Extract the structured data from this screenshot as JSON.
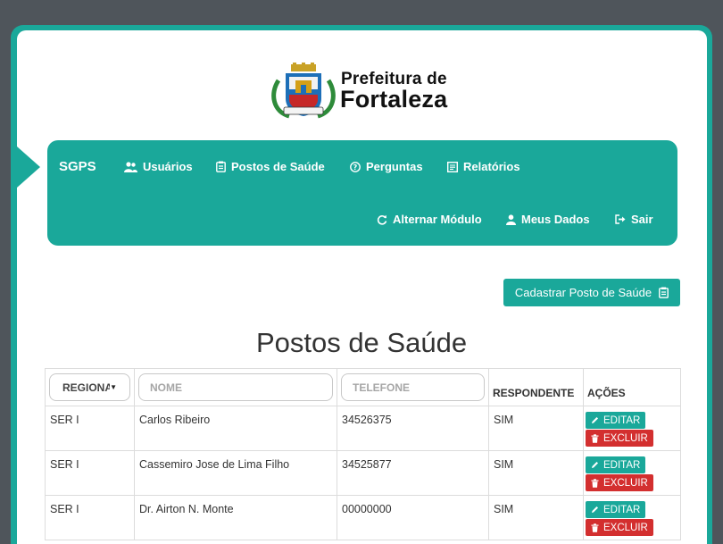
{
  "logo": {
    "line1": "Prefeitura de",
    "line2": "Fortaleza",
    "motto": "FORTITUDINE"
  },
  "navbar": {
    "brand": "SGPS",
    "items": [
      {
        "label": "Usuários",
        "icon": "users-icon"
      },
      {
        "label": "Postos de Saúde",
        "icon": "clipboard-icon"
      },
      {
        "label": "Perguntas",
        "icon": "question-circle-icon"
      },
      {
        "label": "Relatórios",
        "icon": "report-icon"
      }
    ],
    "right_items": [
      {
        "label": "Alternar Módulo",
        "icon": "refresh-icon"
      },
      {
        "label": "Meus Dados",
        "icon": "user-icon"
      },
      {
        "label": "Sair",
        "icon": "sign-out-icon"
      }
    ]
  },
  "add_button": {
    "label": "Cadastrar Posto de Saúde",
    "icon": "clipboard-icon"
  },
  "page_title": "Postos de Saúde",
  "table": {
    "filters": {
      "regional": "REGIONAL",
      "nome_placeholder": "NOME",
      "telefone_placeholder": "TELEFONE"
    },
    "headers": {
      "respondente": "RESPONDENTE",
      "acoes": "AÇÕES"
    },
    "edit_label": "EDITAR",
    "delete_label": "EXCLUIR",
    "rows": [
      {
        "regional": "SER I",
        "nome": "Carlos Ribeiro",
        "telefone": "34526375",
        "respondente": "SIM"
      },
      {
        "regional": "SER I",
        "nome": "Cassemiro Jose de Lima Filho",
        "telefone": "34525877",
        "respondente": "SIM"
      },
      {
        "regional": "SER I",
        "nome": "Dr. Airton N. Monte",
        "telefone": "00000000",
        "respondente": "SIM"
      }
    ]
  },
  "colors": {
    "accent": "#1aa89a",
    "danger": "#d32f2f",
    "background": "#4f555b"
  }
}
